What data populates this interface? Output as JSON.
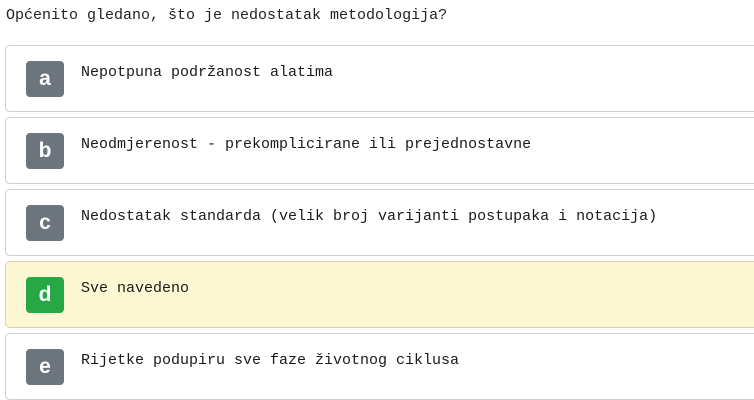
{
  "question": {
    "text": "Općenito gledano, što je nedostatak metodologija?"
  },
  "options": [
    {
      "letter": "a",
      "text": "Nepotpuna podržanost alatima",
      "selected": false
    },
    {
      "letter": "b",
      "text": "Neodmjerenost - prekomplicirane ili prejednostavne",
      "selected": false
    },
    {
      "letter": "c",
      "text": "Nedostatak standarda (velik broj varijanti postupaka i notacija)",
      "selected": false
    },
    {
      "letter": "d",
      "text": "Sve navedeno",
      "selected": true
    },
    {
      "letter": "e",
      "text": "Rijetke podupiru sve faze životnog ciklusa",
      "selected": false
    }
  ],
  "colors": {
    "letter_badge_default": "#6c757d",
    "letter_badge_selected": "#28a745",
    "selected_background": "#fcf8d3",
    "option_border": "#cfcfcf"
  }
}
